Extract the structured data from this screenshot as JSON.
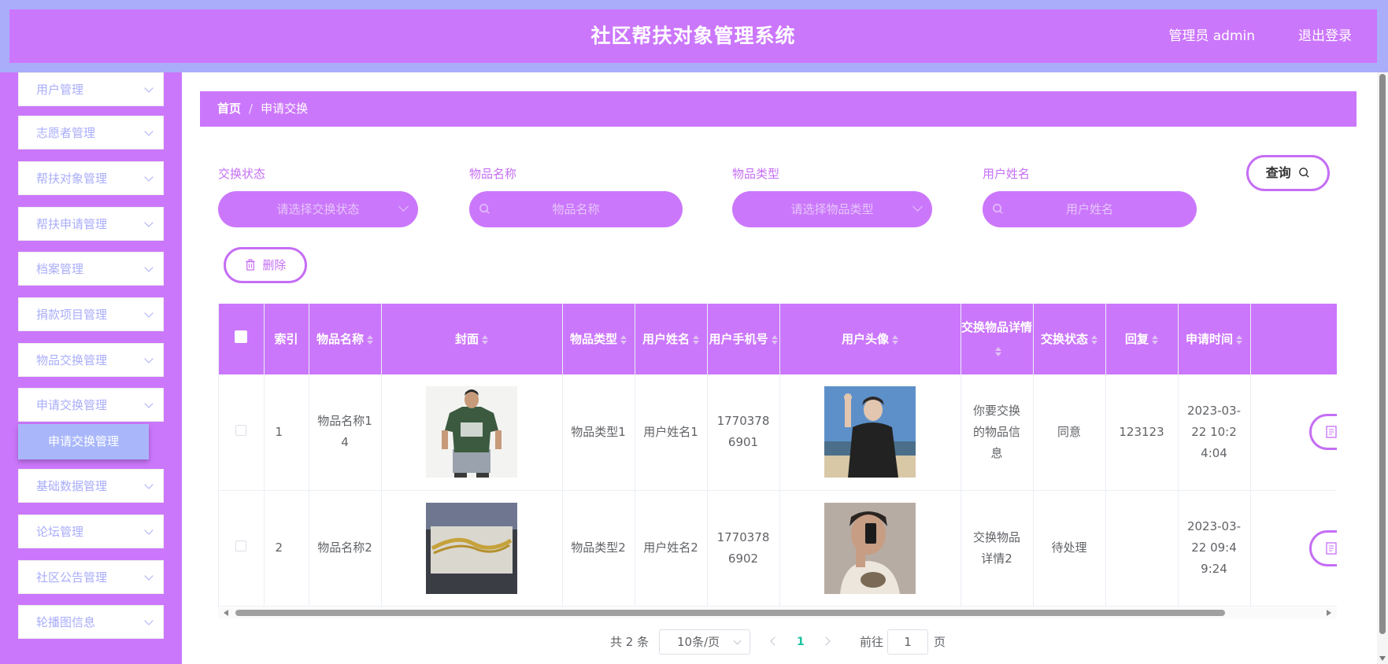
{
  "header": {
    "title": "社区帮扶对象管理系统",
    "admin_label": "管理员 admin",
    "logout": "退出登录"
  },
  "sidebar": {
    "items": [
      {
        "label": "用户管理"
      },
      {
        "label": "志愿者管理"
      },
      {
        "label": "帮扶对象管理"
      },
      {
        "label": "帮扶申请管理"
      },
      {
        "label": "档案管理"
      },
      {
        "label": "捐款项目管理"
      },
      {
        "label": "物品交换管理"
      },
      {
        "label": "申请交换管理"
      },
      {
        "label": "基础数据管理"
      },
      {
        "label": "论坛管理"
      },
      {
        "label": "社区公告管理"
      },
      {
        "label": "轮播图信息"
      }
    ],
    "active_submenu": "申请交换管理"
  },
  "breadcrumb": {
    "home": "首页",
    "separator": "/",
    "current": "申请交换"
  },
  "filters": {
    "status": {
      "label": "交换状态",
      "placeholder": "请选择交换状态"
    },
    "item_name": {
      "label": "物品名称",
      "placeholder": "物品名称"
    },
    "item_type": {
      "label": "物品类型",
      "placeholder": "请选择物品类型"
    },
    "user_name": {
      "label": "用户姓名",
      "placeholder": "用户姓名"
    },
    "query_button": "查询"
  },
  "actions": {
    "delete_button": "删除"
  },
  "table": {
    "columns": [
      "索引",
      "物品名称",
      "封面",
      "物品类型",
      "用户姓名",
      "用户手机号",
      "用户头像",
      "交换物品详情",
      "交换状态",
      "回复",
      "申请时间"
    ],
    "rows": [
      {
        "index": "1",
        "item_name": "物品名称14",
        "cover": "green-tshirt-photo",
        "item_type": "物品类型1",
        "user_name": "用户姓名1",
        "phone": "17703786901",
        "avatar": "user-photo-1",
        "detail": "你要交换的物品信息",
        "status": "同意",
        "reply": "123123",
        "time": "2023-03-22 10:24:04"
      },
      {
        "index": "2",
        "item_name": "物品名称2",
        "cover": "gold-chain-photo",
        "item_type": "物品类型2",
        "user_name": "用户姓名2",
        "phone": "17703786902",
        "avatar": "user-photo-2",
        "detail": "交换物品详情2",
        "status": "待处理",
        "reply": "",
        "time": "2023-03-22 09:49:24"
      }
    ]
  },
  "pagination": {
    "total": "共 2 条",
    "page_size": "10条/页",
    "current_page": "1",
    "goto_label": "前往",
    "goto_value": "1",
    "page_suffix": "页"
  },
  "colors": {
    "primary": "#cb77fb",
    "header_frame": "#a9adfa",
    "menu_text": "#a9adfa",
    "active_submenu": "#a9b7fa",
    "pagination_active": "#19c29e"
  }
}
